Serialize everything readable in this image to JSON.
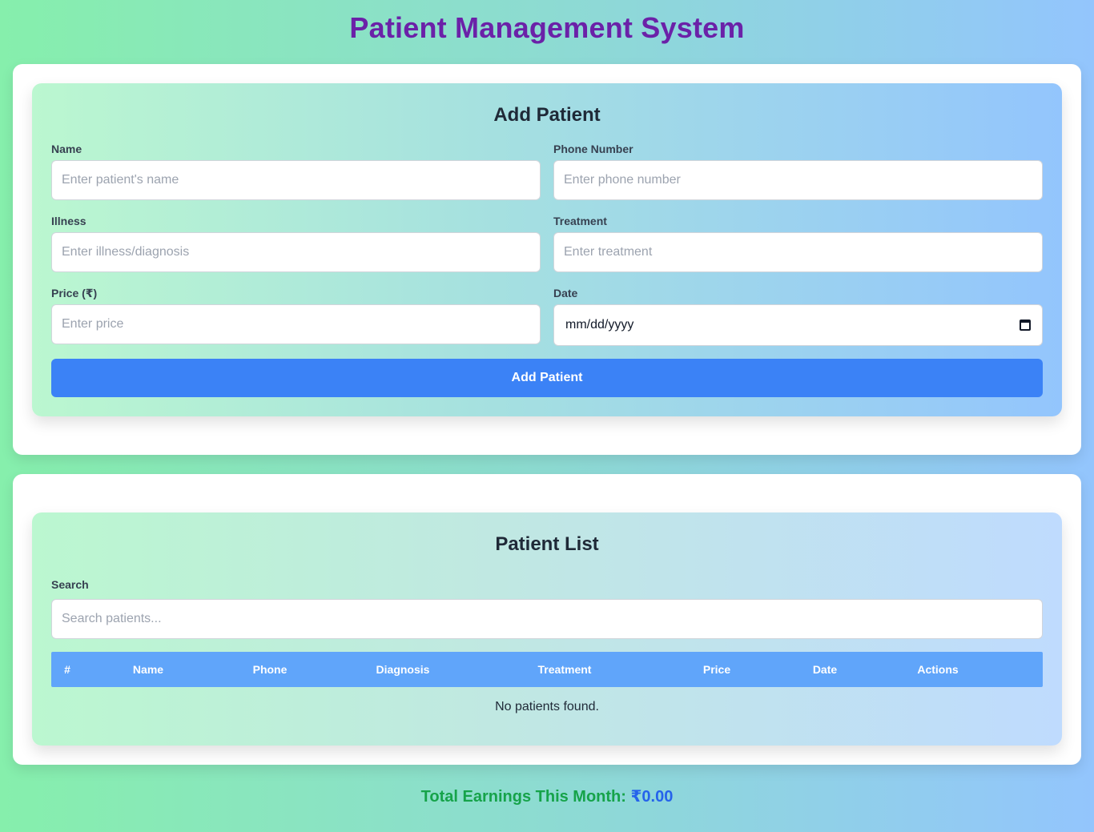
{
  "app": {
    "title": "Patient Management System"
  },
  "form": {
    "title": "Add Patient",
    "name_label": "Name",
    "name_placeholder": "Enter patient's name",
    "phone_label": "Phone Number",
    "phone_placeholder": "Enter phone number",
    "illness_label": "Illness",
    "illness_placeholder": "Enter illness/diagnosis",
    "treatment_label": "Treatment",
    "treatment_placeholder": "Enter treatment",
    "price_label": "Price (₹)",
    "price_placeholder": "Enter price",
    "date_label": "Date",
    "date_value": "mm/dd/yyyy",
    "date_icon": "calendar-icon",
    "submit_label": "Add Patient"
  },
  "list": {
    "title": "Patient List",
    "search_label": "Search",
    "search_placeholder": "Search patients...",
    "columns": [
      "#",
      "Name",
      "Phone",
      "Diagnosis",
      "Treatment",
      "Price",
      "Date",
      "Actions"
    ],
    "rows": [],
    "empty_message": "No patients found."
  },
  "footer": {
    "earnings_label": "Total Earnings This Month:",
    "earnings_value": "₹0.00"
  },
  "colors": {
    "title": "#6b21a8",
    "button": "#3b82f6",
    "table_header": "#60a5fa",
    "earnings_label": "#16a34a",
    "earnings_value": "#2563eb"
  }
}
